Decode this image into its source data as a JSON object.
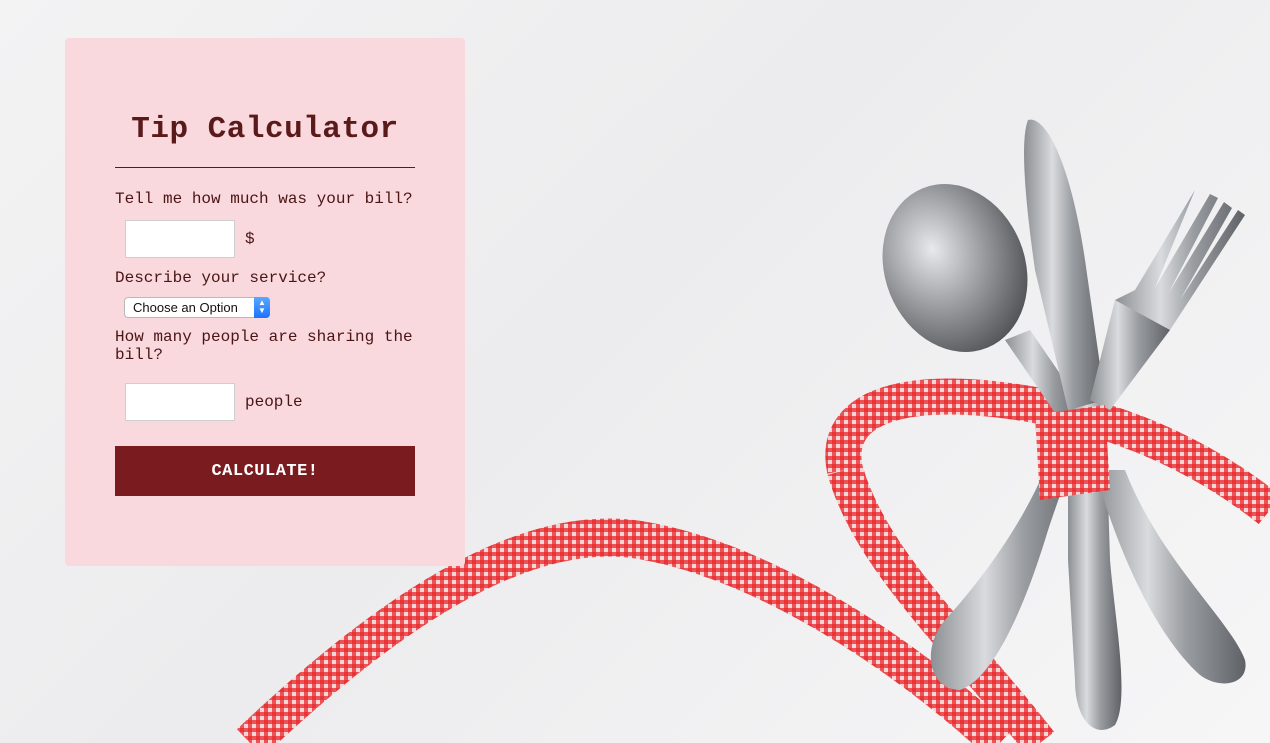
{
  "app": {
    "title": "Tip Calculator"
  },
  "form": {
    "bill_question": "Tell me how much was your bill?",
    "bill_value": "",
    "bill_suffix": "$",
    "service_question": "Describe your service?",
    "service_selected": "Choose an Option",
    "people_question": "How many people are sharing the bill?",
    "people_value": "",
    "people_suffix": "people",
    "calculate_label": "CALCULATE!"
  },
  "colors": {
    "card_bg": "#f9d8de",
    "text": "#5a1a1a",
    "button_bg": "#7a1c1f",
    "ribbon": "#e8282c"
  },
  "icons": {
    "select_arrows": "chevron-updown-icon"
  }
}
